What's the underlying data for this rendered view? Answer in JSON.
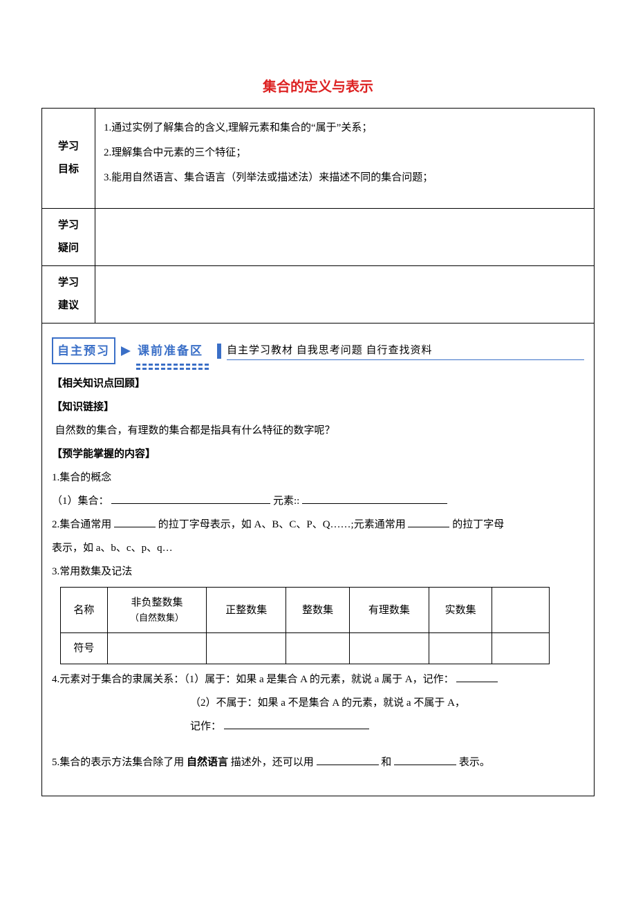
{
  "title": "集合的定义与表示",
  "labels": {
    "goals": "学习\n目标",
    "doubt": "学习\n疑问",
    "advice": "学习\n建议"
  },
  "goals": {
    "g1": "1.通过实例了解集合的含义,理解元素和集合的“属于”关系；",
    "g2": "2.理解集合中元素的三个特征；",
    "g3": "3.能用自然语言、集合语言（列举法或描述法）来描述不同的集合问题；"
  },
  "banner": {
    "box": "自主预习",
    "prep": "课前准备区",
    "slogan": "自主学习教材  自我思考问题  自行查找资料"
  },
  "headings": {
    "review": "【相关知识点回顾】",
    "link": "【知识链接】",
    "grasp": "【预学能掌握的内容】"
  },
  "body": {
    "linkQ": "自然数的集合，有理数的集合都是指具有什么特征的数字呢？",
    "s1": "1.集合的概念",
    "s1a_label": "（1）集合：",
    "s1a_label2": "元素::",
    "s2a": "2.集合通常用",
    "s2b": "的拉丁字母表示，如 A、B、C、P、Q……;元素通常用",
    "s2c": "的拉丁字母",
    "s2d": "表示，如 a、b、c、p、q…",
    "s3": "3.常用数集及记法",
    "s4a": "4.元素对于集合的隶属关系：（1）属于：如果 a 是集合 A 的元素，就说 a 属于 A，记作：",
    "s4b": "（2）不属于：如果 a 不是集合 A 的元素，就说 a 不属于 A，",
    "s4c": "记作：",
    "s5a": "5.集合的表示方法集合除了用",
    "s5bold": "自然语言",
    "s5b": "描述外，还可以用",
    "s5c": "和",
    "s5d": "表示。"
  },
  "table": {
    "rowHeaders": {
      "name": "名称",
      "symbol": "符号"
    },
    "cols": {
      "c1": "非负整数集",
      "c1sub": "（自然数集）",
      "c2": "正整数集",
      "c3": "整数集",
      "c4": "有理数集",
      "c5": "实数集"
    }
  }
}
